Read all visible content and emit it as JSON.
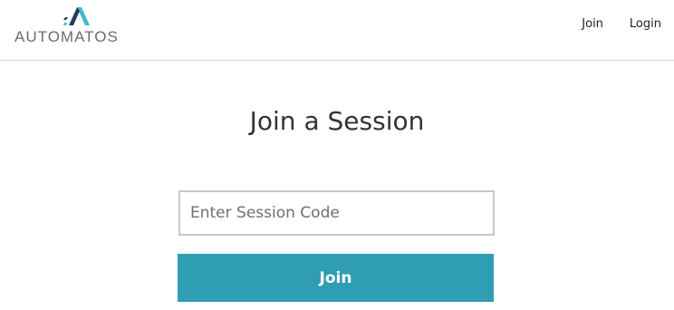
{
  "brand": {
    "name": "AUTOMATOS",
    "icon": "automatos-logo-icon",
    "colors": {
      "mark_dark": "#223f60",
      "mark_light": "#45b8cf",
      "text": "#6d6d6d"
    }
  },
  "nav": {
    "join_label": "Join",
    "login_label": "Login"
  },
  "main": {
    "title": "Join a Session",
    "session_code": {
      "value": "",
      "placeholder": "Enter Session Code"
    },
    "join_button_label": "Join"
  },
  "colors": {
    "accent": "#2f9db4",
    "divider": "#d6d6d6",
    "input_border": "#c9c9c9",
    "text": "#333333"
  }
}
